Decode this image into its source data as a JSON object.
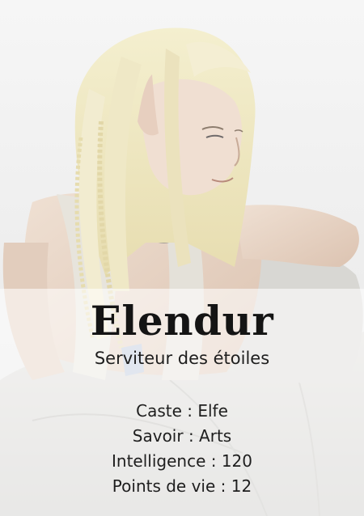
{
  "card": {
    "name": "Elendur",
    "subtitle": "Serviteur des étoiles",
    "stats": [
      {
        "text": "Caste : Elfe"
      },
      {
        "text": "Savoir : Arts"
      },
      {
        "text": "Intelligence : 120"
      },
      {
        "text": "Points de vie : 12"
      }
    ]
  },
  "colors": {
    "background": "#f1f1f1",
    "hair": "#ece6c0",
    "skin": "#e6d2c2",
    "clothing": "#d4d4d0",
    "text": "#141414"
  }
}
